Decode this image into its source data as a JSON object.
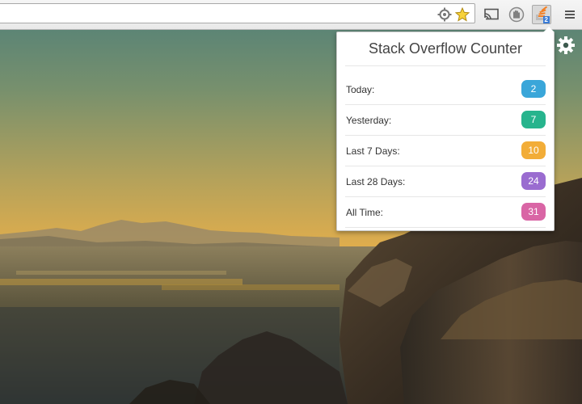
{
  "extension_popup": {
    "title": "Stack Overflow Counter",
    "stats": [
      {
        "label": "Today:",
        "count": "2",
        "color": "#3aa6d9"
      },
      {
        "label": "Yesterday:",
        "count": "7",
        "color": "#27b48d"
      },
      {
        "label": "Last 7 Days:",
        "count": "10",
        "color": "#f2ad38"
      },
      {
        "label": "Last 28 Days:",
        "count": "24",
        "color": "#9a6cd0"
      },
      {
        "label": "All Time:",
        "count": "31",
        "color": "#d965a5"
      }
    ]
  },
  "toolbar": {
    "icons": [
      "location-target-icon",
      "bookmark-star-icon",
      "cast-icon",
      "ad-block-hand-icon",
      "stack-overflow-counter-icon",
      "chrome-menu-icon"
    ],
    "extension_badge": "2"
  },
  "wallpaper": {
    "settings_icon": "gear-icon"
  }
}
